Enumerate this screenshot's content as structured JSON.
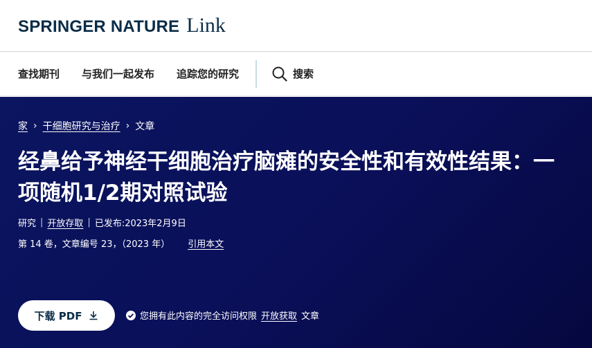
{
  "header": {
    "brand": "SPRINGER NATURE",
    "product": "Link"
  },
  "nav": {
    "items": [
      "查找期刊",
      "与我们一起发布",
      "追踪您的研究"
    ],
    "search_label": "搜索"
  },
  "breadcrumb": {
    "home": "家",
    "journal": "干细胞研究与治疗",
    "current": "文章"
  },
  "article": {
    "title": "经鼻给予神经干细胞治疗脑瘫的安全性和有效性结果：一项随机1/2期对照试验",
    "type": "研究",
    "access": "开放存取",
    "published": "已发布:2023年2月9日",
    "volume_info": "第 14 卷，文章编号 23，（2023 年）",
    "cite_label": "引用本文"
  },
  "actions": {
    "pdf_label": "下载 PDF",
    "access_text": "您拥有此内容的完全访问权限",
    "access_link": "开放获取",
    "access_tail": "文章"
  },
  "colors": {
    "brand": "#0a2c47",
    "hero_bg": "#0a0f58"
  }
}
